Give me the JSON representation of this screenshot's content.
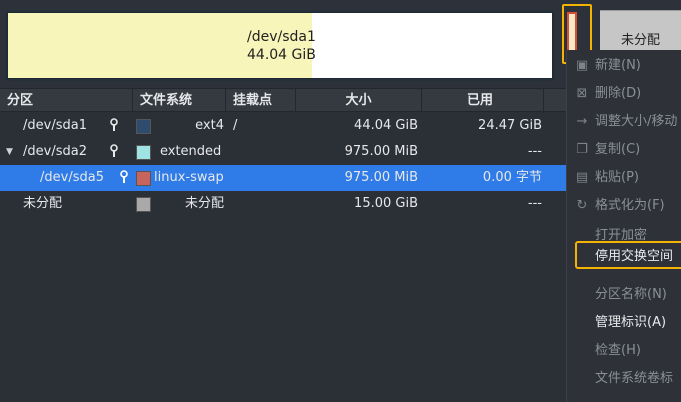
{
  "disk_map": {
    "sda1_name": "/dev/sda1",
    "sda1_size": "44.04 GiB",
    "unallocated_label": "未分配",
    "colors": {
      "sda1_used": "#f7f5b9",
      "sda1_free": "#ffffff",
      "unallocated": "#c6c6c6",
      "highlight": "#f3b300"
    }
  },
  "table": {
    "columns": [
      "分区",
      "文件系统",
      "挂载点",
      "大小",
      "已用"
    ],
    "rows": [
      {
        "partition": "/dev/sda1",
        "filesystem": "ext4",
        "mount": "/",
        "size": "44.04 GiB",
        "used": "24.47 GiB",
        "swatch": "#2f4c6e",
        "locked": true,
        "expander": "",
        "selected": false
      },
      {
        "partition": "/dev/sda2",
        "filesystem": "extended",
        "mount": "",
        "size": "975.00 MiB",
        "used": "---",
        "swatch": "#9fe3e3",
        "locked": true,
        "expander": "▼",
        "selected": false
      },
      {
        "partition": "/dev/sda5",
        "filesystem": "linux-swap",
        "mount": "",
        "size": "975.00 MiB",
        "used": "0.00 字节",
        "swatch": "#c8645e",
        "locked": true,
        "expander": "",
        "selected": true
      },
      {
        "partition": "未分配",
        "filesystem": "未分配",
        "mount": "",
        "size": "15.00 GiB",
        "used": "---",
        "swatch": "#a9a9a9",
        "locked": false,
        "expander": "",
        "selected": false
      }
    ]
  },
  "context_menu": {
    "items": [
      {
        "label": "新建(N)",
        "icon": "new-partition-icon",
        "enabled": false
      },
      {
        "label": "删除(D)",
        "icon": "delete-icon",
        "enabled": false
      },
      {
        "label": "调整大小/移动",
        "icon": "resize-move-icon",
        "enabled": false
      },
      {
        "label": "复制(C)",
        "icon": "copy-icon",
        "enabled": false
      },
      {
        "label": "粘贴(P)",
        "icon": "paste-icon",
        "enabled": false
      },
      {
        "label": "格式化为(F)",
        "icon": "format-icon",
        "enabled": false
      },
      {
        "label": "打开加密",
        "icon": "",
        "enabled": false
      },
      {
        "label": "停用交换空间",
        "icon": "",
        "enabled": true,
        "highlighted": true
      },
      {
        "label": "分区名称(N)",
        "icon": "",
        "enabled": false
      },
      {
        "label": "管理标识(A)",
        "icon": "",
        "enabled": true
      },
      {
        "label": "检查(H)",
        "icon": "",
        "enabled": false
      },
      {
        "label": "文件系统卷标",
        "icon": "",
        "enabled": false
      }
    ]
  }
}
